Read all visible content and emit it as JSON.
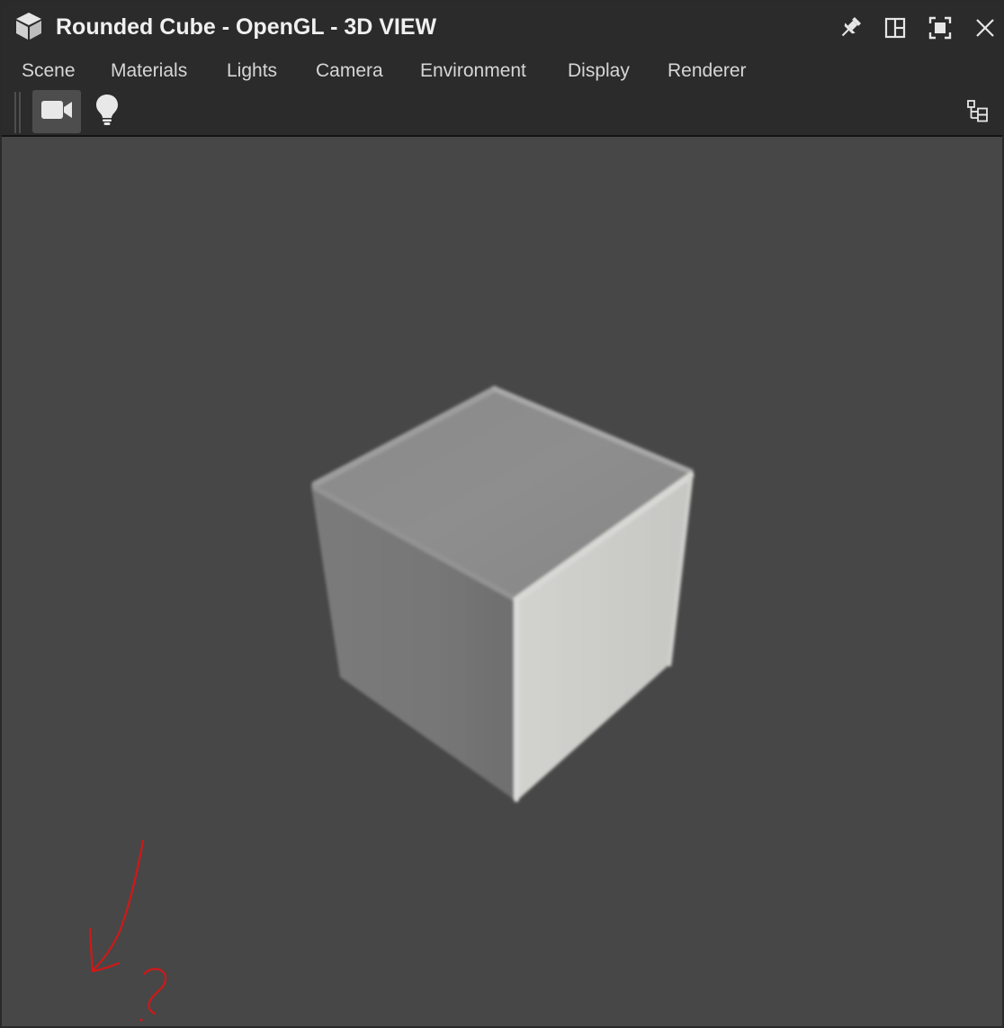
{
  "window": {
    "title": "Rounded Cube - OpenGL - 3D VIEW",
    "app_icon": "cube-icon",
    "controls": [
      {
        "name": "pin-button",
        "icon": "pin-icon"
      },
      {
        "name": "split-layout-button",
        "icon": "split-layout-icon"
      },
      {
        "name": "maximize-button",
        "icon": "maximize-icon"
      },
      {
        "name": "close-button",
        "icon": "close-icon"
      }
    ]
  },
  "menu": {
    "items": [
      "Scene",
      "Materials",
      "Lights",
      "Camera",
      "Environment",
      "Display",
      "Renderer"
    ]
  },
  "toolbar": {
    "tools": [
      {
        "name": "camera-tool-button",
        "icon": "video-camera-icon",
        "active": true
      },
      {
        "name": "light-tool-button",
        "icon": "lightbulb-icon",
        "active": false
      }
    ],
    "scene_tree_icon": "scene-tree-icon"
  },
  "viewport": {
    "object": "rounded cube",
    "background_color": "#474747",
    "annotation_color": "#d01818",
    "annotation": "?"
  },
  "colors": {
    "titlebar_bg": "#2b2b2b",
    "menu_text": "#d6d6d6",
    "title_text": "#f0f0f0",
    "active_tool_bg": "#4d4d4d"
  }
}
